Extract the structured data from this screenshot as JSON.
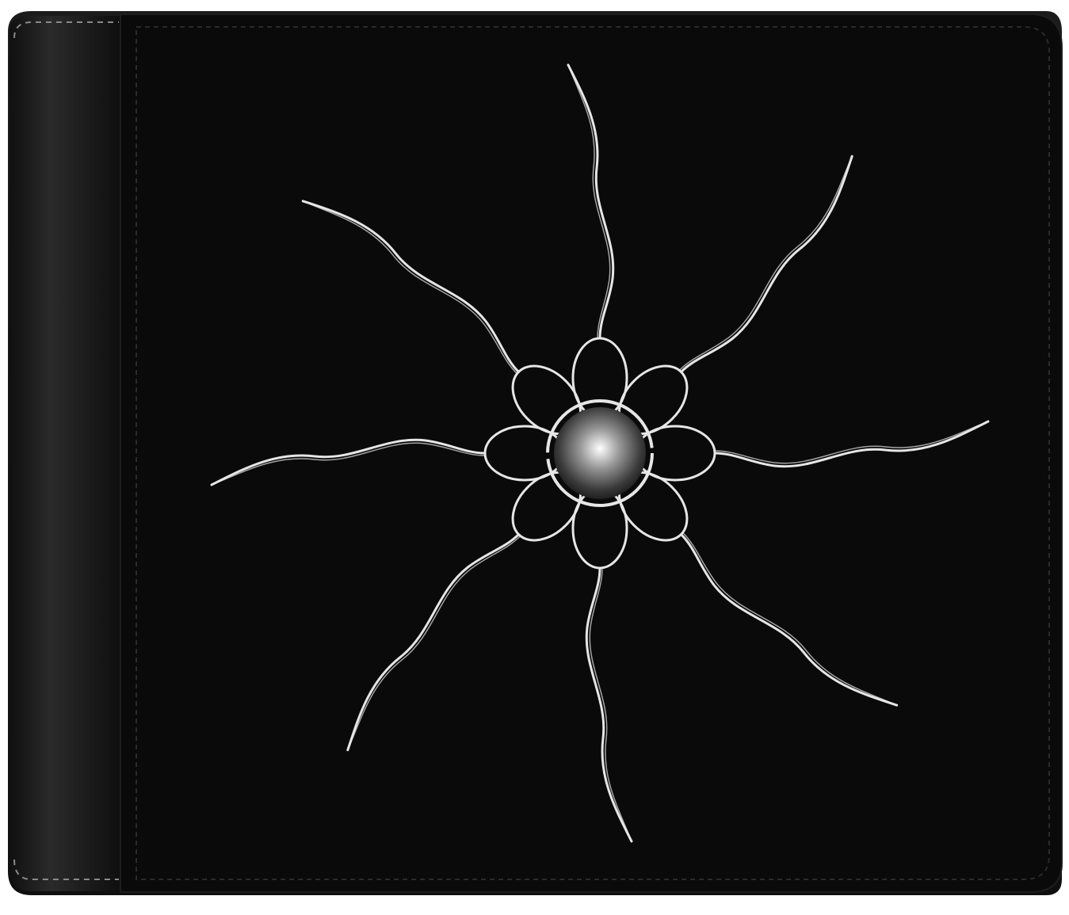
{
  "product": {
    "kind": "bifold-wallet",
    "colors": {
      "background": "#ffffff",
      "leather": "#0d0d0d",
      "spine": "#1a1a1a",
      "stitch": "#9a9a9a",
      "line_art": "#e6e6e6"
    },
    "artwork": {
      "motif": "sperm-cells-around-egg",
      "sperm_count": 8,
      "egg_fill": "radial-grey-gradient"
    }
  }
}
